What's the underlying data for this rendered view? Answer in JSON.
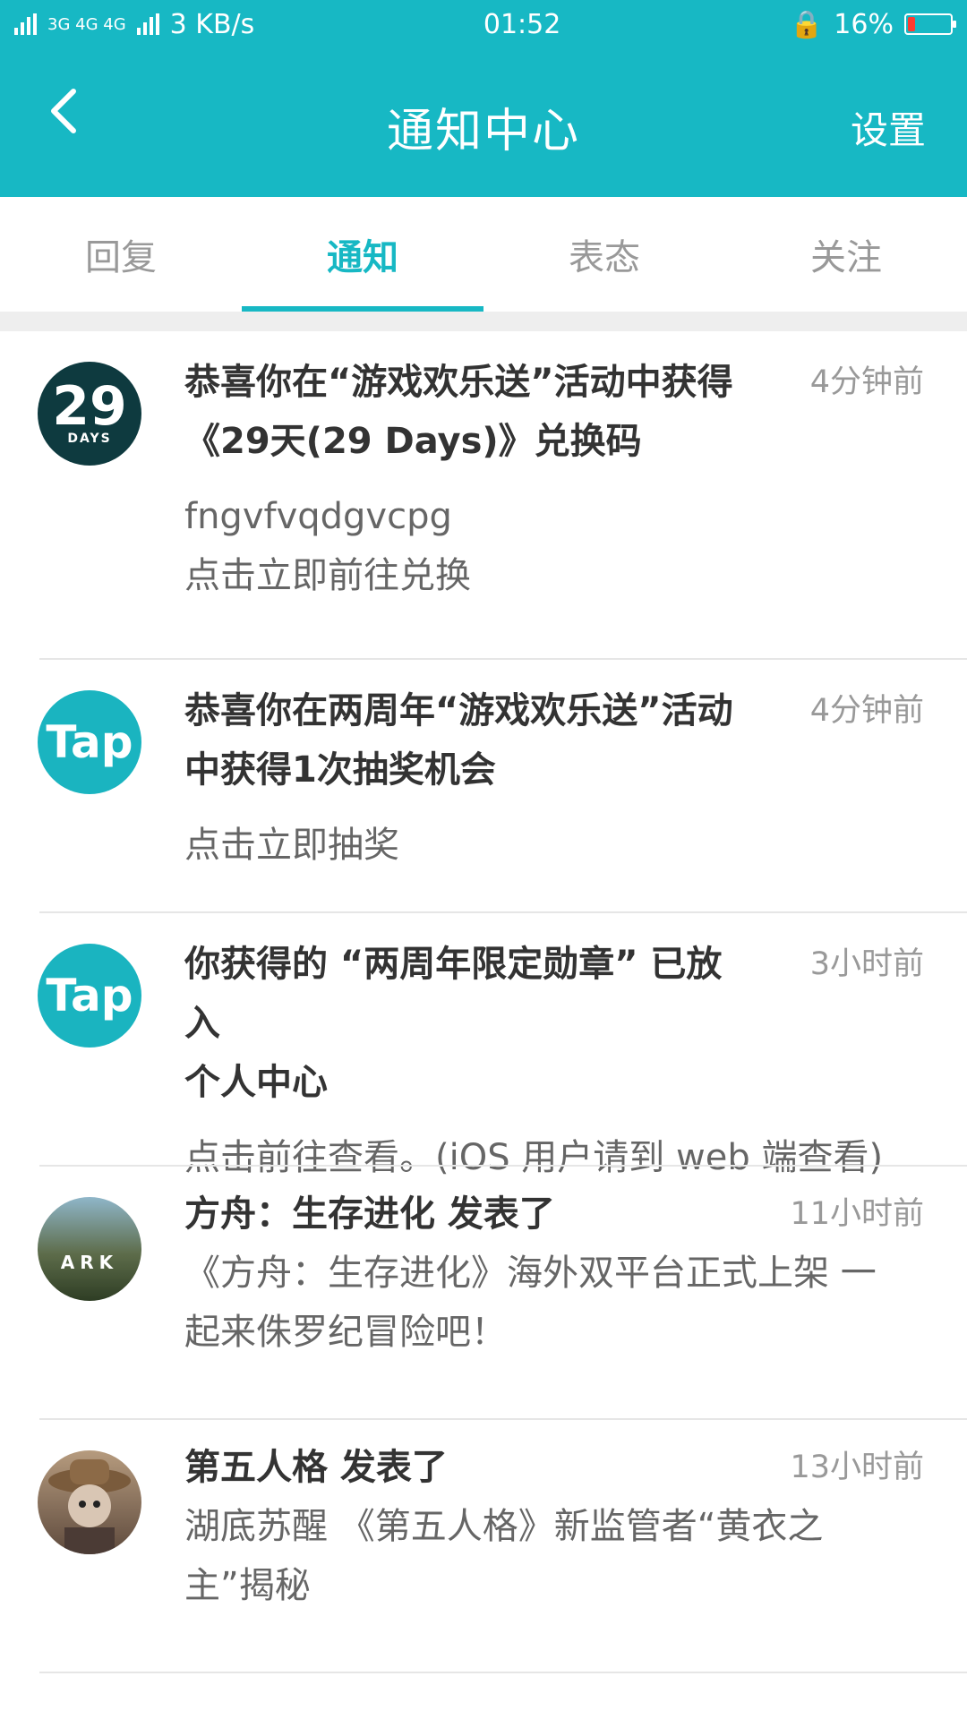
{
  "statusbar": {
    "network": "3G 4G 4G",
    "speed": "3 KB/s",
    "time": "01:52",
    "battery": "16%"
  },
  "appbar": {
    "title": "通知中心",
    "settings": "设置"
  },
  "tabs": [
    {
      "label": "回复"
    },
    {
      "label": "通知"
    },
    {
      "label": "表态"
    },
    {
      "label": "关注"
    }
  ],
  "notifications": [
    {
      "title_line1": "恭喜你在“游戏欢乐送”活动中获得",
      "title_line2": "《29天(29 Days)》兑换码",
      "time": "4分钟前",
      "body_line1": "fngvfvqdgvcpg",
      "body_line2": "点击立即前往兑换",
      "avatar_text": "29",
      "avatar_sub": "DAYS"
    },
    {
      "title_line1": "恭喜你在两周年“游戏欢乐送”活动",
      "title_line2": "中获得1次抽奖机会",
      "time": "4分钟前",
      "body_line1": "点击立即抽奖",
      "avatar_text": "Tap"
    },
    {
      "title_line1": "你获得的 “两周年限定勋章” 已放入",
      "title_line2": "个人中心",
      "time": "3小时前",
      "body_line1": "点击前往查看。(iOS 用户请到 web 端查看)",
      "avatar_text": "Tap"
    },
    {
      "title_line1": "方舟：生存进化 发表了",
      "time": "11小时前",
      "body_line1": "《方舟：生存进化》海外双平台正式上架 一",
      "body_line2": "起来侏罗纪冒险吧！",
      "avatar_text": "ARK"
    },
    {
      "title_line1": "第五人格 发表了",
      "time": "13小时前",
      "body_line1": "湖底苏醒 《第五人格》新监管者“黄衣之",
      "body_line2": "主”揭秘"
    }
  ]
}
